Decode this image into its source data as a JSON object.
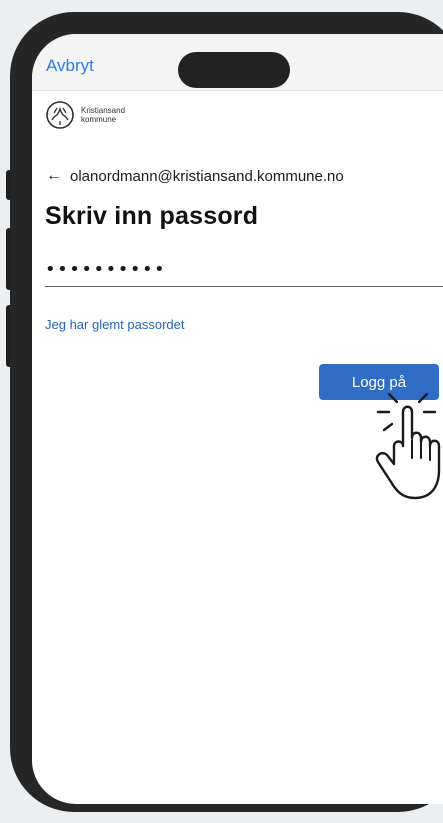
{
  "nav": {
    "cancel_label": "Avbryt"
  },
  "org": {
    "line1": "Kristiansand",
    "line2": "kommune"
  },
  "login": {
    "back_arrow": "←",
    "email": "olanordmann@kristiansand.kommune.no",
    "title": "Skriv inn passord",
    "password_value": "••••••••••",
    "forgot_link": "Jeg har glemt passordet",
    "submit_label": "Logg på"
  },
  "icons": [
    "back-arrow-icon",
    "org-logo",
    "pointer-hand-icon"
  ],
  "colors": {
    "accent": "#2f6dc7",
    "link": "#2465b8",
    "phone_frame": "#262626"
  }
}
